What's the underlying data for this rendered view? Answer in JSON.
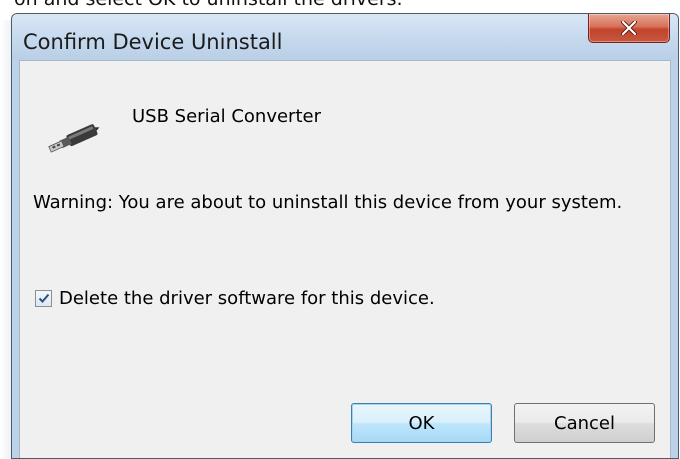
{
  "background": {
    "partial_text": "on and select OK to uninstall the drivers."
  },
  "dialog": {
    "title": "Confirm Device Uninstall",
    "close_icon": "close-icon",
    "device_icon": "usb-plug-icon",
    "device_name": "USB Serial Converter",
    "warning": "Warning: You are about to uninstall this device from your system.",
    "checkbox": {
      "label": "Delete the driver software for this device.",
      "checked": true
    },
    "ok_label": "OK",
    "cancel_label": "Cancel"
  },
  "colors": {
    "close_button": "#c8583f",
    "titlebar": "#c5d9ee",
    "client_bg": "#f0f0f0",
    "default_button_border": "#3c7fb1"
  }
}
